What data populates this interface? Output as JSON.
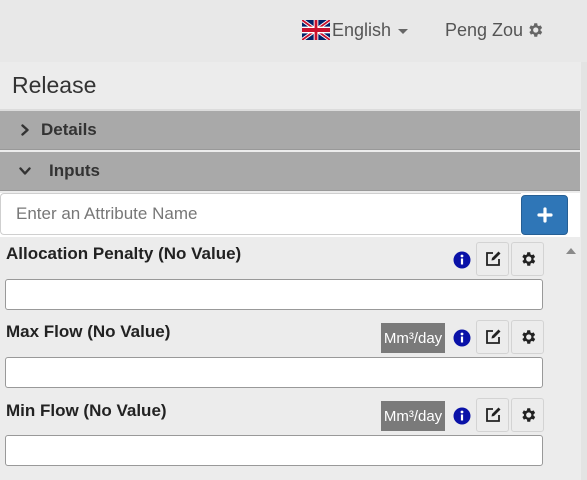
{
  "header": {
    "language_label": "English",
    "user_label": "Peng Zou",
    "icons": {
      "language": "uk-flag-icon",
      "language_caret": "caret-down-icon",
      "user_settings": "gear-icon"
    }
  },
  "panel": {
    "title": "Release",
    "sections": [
      {
        "label": "Details",
        "state": "collapsed",
        "icon": "chevron-right-icon"
      },
      {
        "label": "Inputs",
        "state": "expanded",
        "icon": "chevron-down-icon"
      }
    ],
    "search": {
      "placeholder": "Enter an Attribute Name",
      "value": ""
    },
    "add_button_icon": "plus-icon"
  },
  "attributes": [
    {
      "name": "Allocation Penalty (No Value)",
      "unit": "",
      "value": ""
    },
    {
      "name": "Max Flow (No Value)",
      "unit": "Mm³/day",
      "value": ""
    },
    {
      "name": "Min Flow (No Value)",
      "unit": "Mm³/day",
      "value": ""
    }
  ],
  "colors": {
    "accent": "#2f76b7",
    "info_icon": "#0a12a8",
    "accordion": "#a9a9a9",
    "unit_badge": "#7a7a7a"
  }
}
